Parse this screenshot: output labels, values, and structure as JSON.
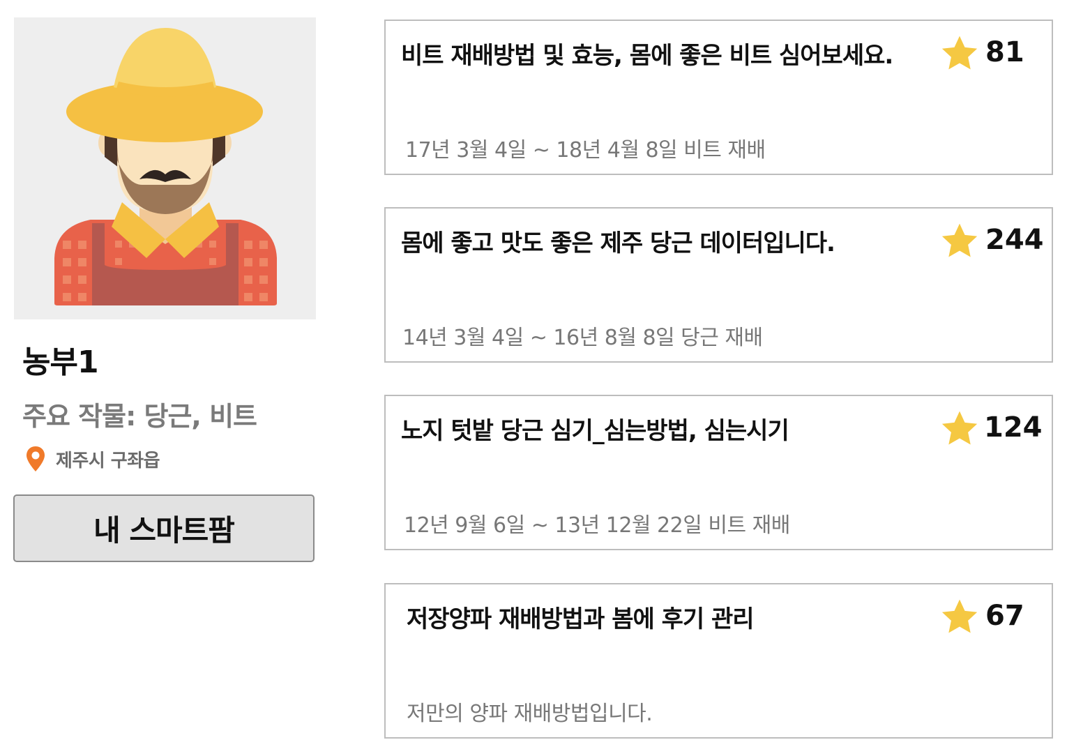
{
  "profile": {
    "avatar_icon": "farmer-avatar-icon",
    "name": "농부1",
    "main_crops": "주요 작물: 당근, 비트",
    "location_icon": "map-pin-icon",
    "location": "제주시 구좌읍",
    "smartfarm_button": "내 스마트팜"
  },
  "colors": {
    "star": "#f5c842",
    "pin": "#f07a2a",
    "card_border": "#bdbdbd",
    "button_bg": "#e2e2e2"
  },
  "posts": [
    {
      "title": "비트 재배방법 및 효능, 몸에 좋은 비트 심어보세요.",
      "subtitle": "17년 3월 4일 ~ 18년 4월 8일 비트 재배",
      "count": "81"
    },
    {
      "title": "몸에 좋고 맛도 좋은 제주 당근 데이터입니다.",
      "subtitle": "14년 3월 4일 ~ 16년 8월 8일 당근 재배",
      "count": "244"
    },
    {
      "title": "노지 텃밭 당근 심기_심는방법, 심는시기",
      "subtitle": "12년 9월 6일 ~ 13년 12월 22일 비트 재배",
      "count": "124"
    },
    {
      "title": "저장양파 재배방법과 봄에 후기 관리",
      "subtitle": "저만의 양파 재배방법입니다.",
      "count": "67"
    }
  ]
}
